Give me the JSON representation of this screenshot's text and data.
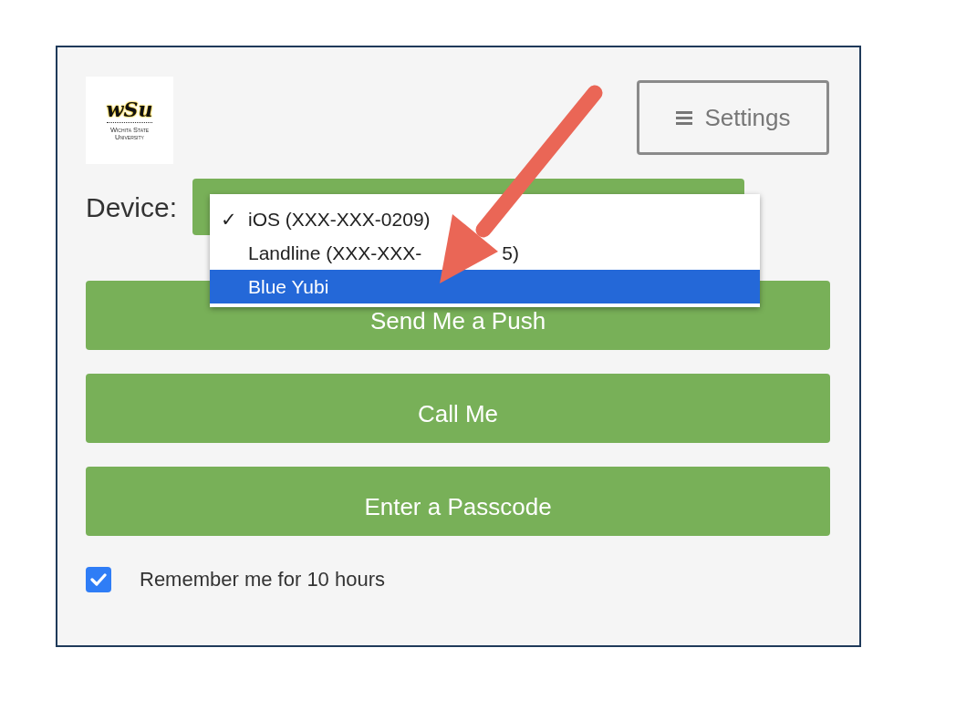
{
  "logo": {
    "mark": "wSu",
    "lines": [
      "Wichita State",
      "University"
    ]
  },
  "settings_button": {
    "label": "Settings"
  },
  "device": {
    "label": "Device:",
    "check_mark": "✓",
    "expanded": true,
    "options": [
      {
        "label": "iOS (XXX-XXX-0209)",
        "checked": true,
        "selected": false
      },
      {
        "label": "Landline (XXX-XXX-",
        "label_end": "5)",
        "checked": false,
        "selected": false
      },
      {
        "label": "Blue Yubi",
        "checked": false,
        "selected": true
      }
    ]
  },
  "buttons": [
    {
      "label": "Send Me a Push"
    },
    {
      "label": "Call Me"
    },
    {
      "label": "Enter a Passcode"
    }
  ],
  "remember": {
    "label": "Remember me for 10 hours",
    "checked": true
  }
}
